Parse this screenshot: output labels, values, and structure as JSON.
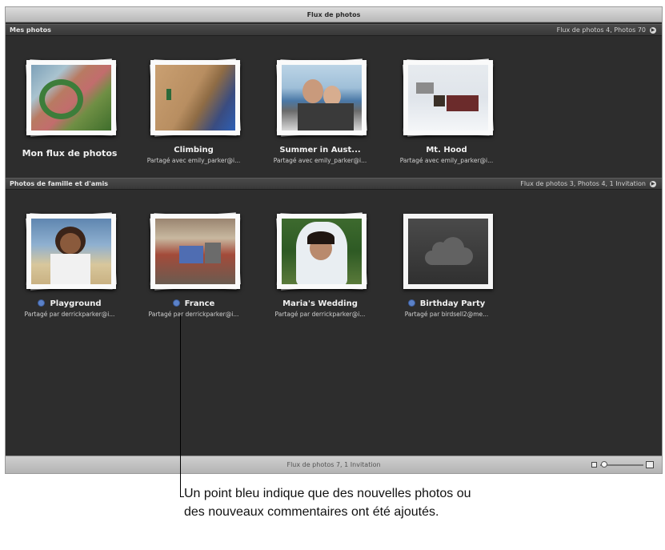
{
  "window": {
    "title": "Flux de photos"
  },
  "my_photos": {
    "header": "Mes photos",
    "summary": "Flux de photos 4, Photos 70",
    "streams": [
      {
        "title": "Mon flux de photos",
        "subtitle": ""
      },
      {
        "title": "Climbing",
        "subtitle": "Partagé avec emily_parker@i..."
      },
      {
        "title": "Summer in Aust...",
        "subtitle": "Partagé avec emily_parker@i..."
      },
      {
        "title": "Mt. Hood",
        "subtitle": "Partagé avec emily_parker@i..."
      }
    ]
  },
  "family": {
    "header": "Photos de famille et d'amis",
    "summary": "Flux de photos 3, Photos 4, 1 Invitation",
    "streams": [
      {
        "title": "Playground",
        "subtitle": "Partagé par derrickparker@i...",
        "new": true
      },
      {
        "title": "France",
        "subtitle": "Partagé par derrickparker@i...",
        "new": true
      },
      {
        "title": "Maria's Wedding",
        "subtitle": "Partagé par derrickparker@i...",
        "new": false
      },
      {
        "title": "Birthday Party",
        "subtitle": "Partagé par birdsell2@me...",
        "new": true
      }
    ]
  },
  "footer": {
    "status": "Flux de photos 7, 1 Invitation"
  },
  "callout": {
    "text": "Un point bleu indique que des nouvelles photos ou des nouveaux commentaires ont été ajoutés."
  },
  "colors": {
    "background": "#2d2d2d",
    "new_dot": "#5b82c9"
  }
}
